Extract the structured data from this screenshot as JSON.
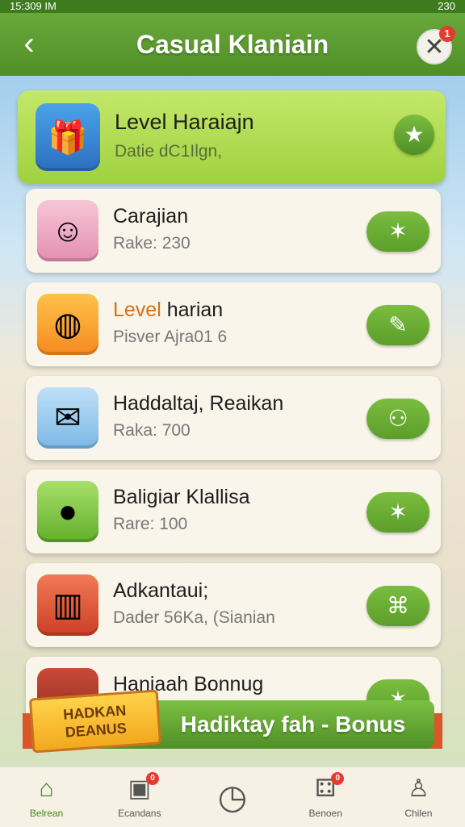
{
  "status": {
    "time": "15:309 IM",
    "battery": "230"
  },
  "header": {
    "title": "Casual Klaniain",
    "close_badge": "1"
  },
  "featured": {
    "title": "Level Haraiajn",
    "subtitle": "Datie dC1Ilgn,",
    "thumb_icon": "gift-box-icon",
    "action_icon": "star-icon"
  },
  "items": [
    {
      "title": "Carajian",
      "subtitle": "Rake: 230",
      "icon": "boy-face-icon",
      "action": "✶",
      "thumb_color": "#f4b7c8"
    },
    {
      "title_a": "Level",
      "title_b": " harian",
      "subtitle": "Pisver Ajra01 6",
      "icon": "orange-slice-icon",
      "action": "✎",
      "thumb_color": "#f6a72a"
    },
    {
      "title": "Haddaltaj, Reaikan",
      "subtitle": "Raka: 700",
      "icon": "treasure-scroll-icon",
      "action": "⚇",
      "thumb_color": "#a8d2f0"
    },
    {
      "title": "Baligiar Klallisa",
      "subtitle": "Rare: 100",
      "icon": "orange-fruit-icon",
      "action": "✶",
      "thumb_color": "#8fd250"
    },
    {
      "title": "Adkantaui;",
      "subtitle": "Dader 56Ka, (Sianian",
      "icon": "popcorn-bucket-icon",
      "action": "⌘",
      "thumb_color": "#e45a3b"
    },
    {
      "title": "Haniaah Bonnug",
      "subtitle": "",
      "icon": "bowl-icon",
      "action": "✶",
      "thumb_color": "#b23b2e"
    }
  ],
  "banner": {
    "tag": "HADKAN DEANUS",
    "label": "Hadiktay fah - Bonus"
  },
  "tabs": [
    {
      "label": "Belrean",
      "icon": "home-icon",
      "glyph": "⌂",
      "badge": ""
    },
    {
      "label": "Ecandans",
      "icon": "calendar-icon",
      "glyph": "▣",
      "badge": "0"
    },
    {
      "label": "",
      "icon": "compass-icon",
      "glyph": "◷",
      "badge": ""
    },
    {
      "label": "Benoen",
      "icon": "dice-icon",
      "glyph": "⚃",
      "badge": "0"
    },
    {
      "label": "Chilen",
      "icon": "profile-icon",
      "glyph": "♙",
      "badge": ""
    }
  ]
}
